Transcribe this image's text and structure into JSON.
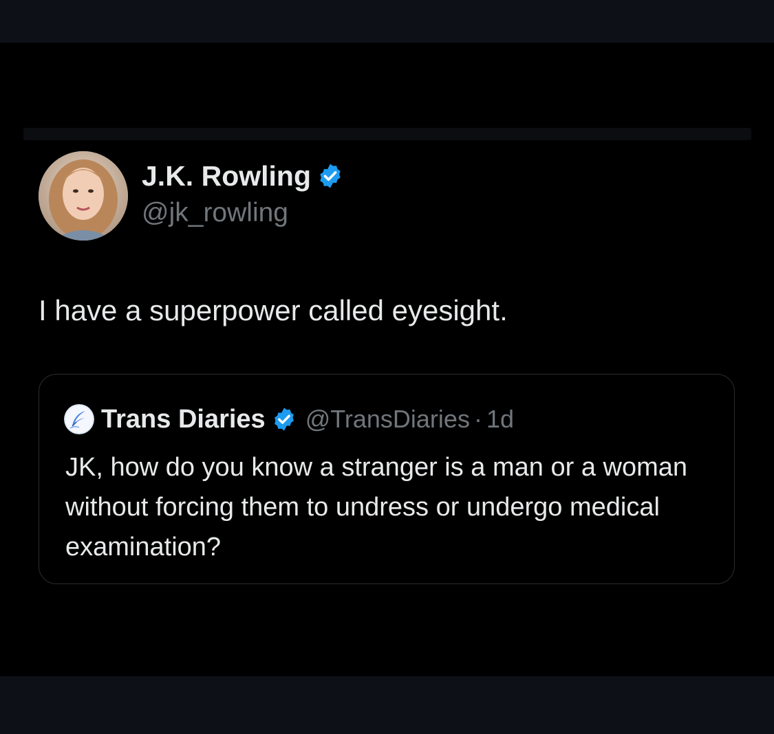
{
  "colors": {
    "background": "#000000",
    "frame": "#0d1117",
    "text_primary": "#e7e9ea",
    "text_secondary": "#71767b",
    "verified_blue": "#1d9bf0",
    "card_border": "#2a2d31"
  },
  "tweet": {
    "author": {
      "name": "J.K. Rowling",
      "handle": "@jk_rowling",
      "verified_icon": "verified-badge-icon",
      "avatar": "avatar-photo"
    },
    "text": "I have a superpower called eyesight.",
    "quoted_tweet": {
      "author_name": "Trans Diaries",
      "handle": "@TransDiaries",
      "separator": "·",
      "time": "1d",
      "verified_icon": "verified-badge-icon",
      "avatar": "feather-logo-avatar",
      "text": "JK, how do you know a stranger is a man or a woman without forcing them to undress or undergo medical examination?"
    }
  }
}
